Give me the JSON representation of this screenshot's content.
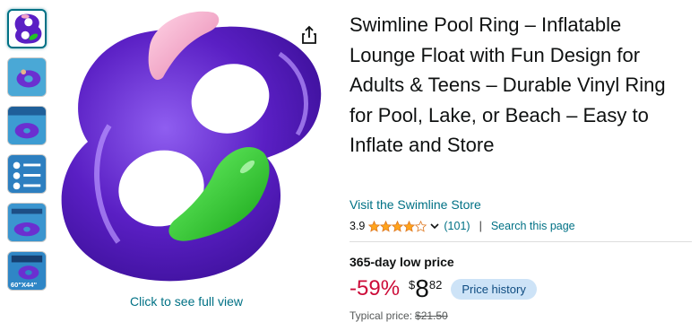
{
  "product": {
    "title": "Swimline Pool Ring – Inflatable Lounge Float with Fun Design for Adults & Teens – Durable Vinyl Ring for Pool, Lake, or Beach – Easy to Inflate and Store",
    "store_link": "Visit the Swimline Store"
  },
  "gallery": {
    "full_view_label": "Click to see full view",
    "thumbnails": [
      {
        "icon": "float-purple-thumb"
      },
      {
        "icon": "lifestyle-thumb"
      },
      {
        "icon": "feature-thumb"
      },
      {
        "icon": "feature-thumb"
      },
      {
        "icon": "feature-thumb"
      },
      {
        "icon": "size-thumb",
        "text": "60\"X44\""
      }
    ]
  },
  "rating": {
    "value": "3.9",
    "stars": 3.9,
    "count": "(101)",
    "search_link": "Search this page",
    "separator": "|"
  },
  "pricing": {
    "deal_label": "365-day low price",
    "discount": "-59%",
    "currency": "$",
    "whole": "8",
    "fraction": "82",
    "history_button": "Price history",
    "typical_label": "Typical price:",
    "typical_value": "$21.50"
  },
  "colors": {
    "link": "#007185",
    "discount": "#CC0C39",
    "star": "#FFA41C",
    "float_purple": "#5a1fc4",
    "float_green": "#22c423",
    "float_pink": "#f5a6c8"
  }
}
